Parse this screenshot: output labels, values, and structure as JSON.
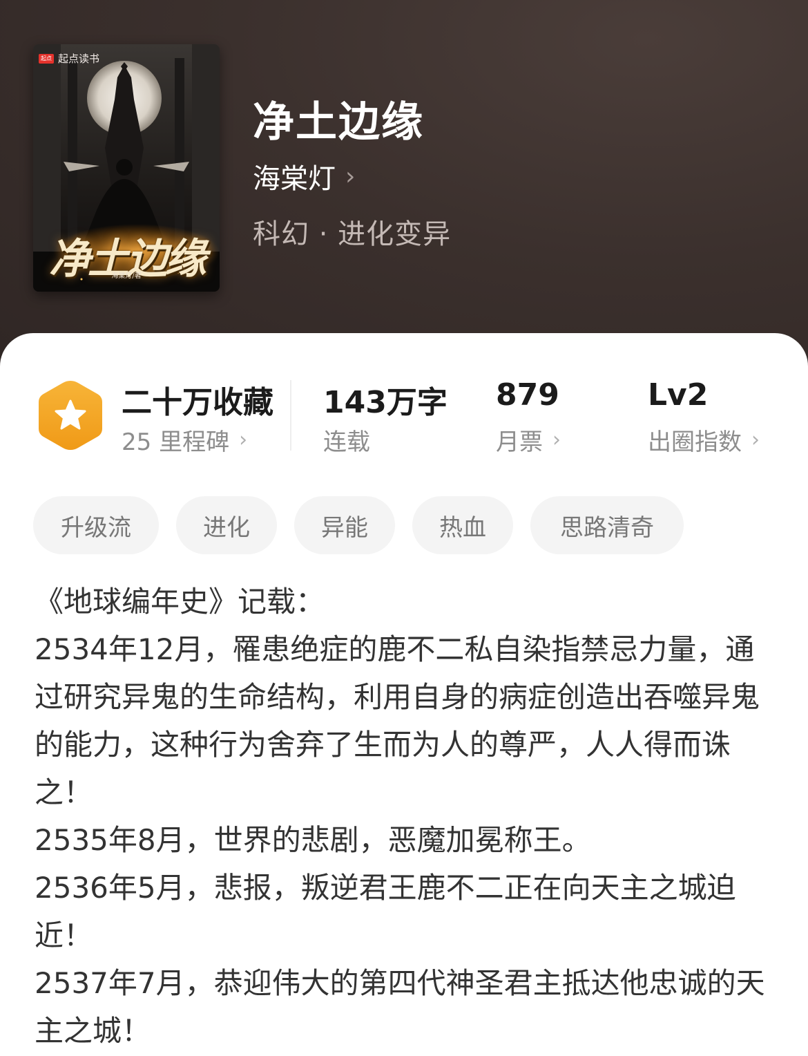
{
  "cover": {
    "brand": "起点读书",
    "brand_mark": "起点",
    "title": "净土边缘",
    "author": "海棠灯/著"
  },
  "book": {
    "title": "净土边缘",
    "author": "海棠灯",
    "genre": "科幻 · 进化变异"
  },
  "stats": {
    "collection": {
      "value": "二十万收藏",
      "label": "25 里程碑"
    },
    "words": {
      "value": "143万字",
      "label": "连载"
    },
    "monthly_tickets": {
      "value": "879",
      "label": "月票"
    },
    "breakout": {
      "value": "Lv2",
      "label": "出圈指数"
    }
  },
  "tags": [
    "升级流",
    "进化",
    "异能",
    "热血",
    "思路清奇"
  ],
  "synopsis": [
    "《地球编年史》记载：",
    "2534年12月，罹患绝症的鹿不二私自染指禁忌力量，通过研究异鬼的生命结构，利用自身的病症创造出吞噬异鬼的能力，这种行为舍弃了生而为人的尊严，人人得而诛之！",
    "2535年8月，世界的悲剧，恶魔加冕称王。",
    "2536年5月，悲报，叛逆君王鹿不二正在向天主之城迫近！",
    "2537年7月，恭迎伟大的第四代神圣君主抵达他忠诚的天主之城！"
  ],
  "icons": {
    "chevron": "chevron-right-icon",
    "badge": "star-badge-icon"
  },
  "colors": {
    "hero_bg": "#3b302d",
    "badge": "#f5a623",
    "text_primary": "#1b1b1b",
    "text_secondary": "#8d8d8d",
    "tag_bg": "#f4f4f4"
  }
}
